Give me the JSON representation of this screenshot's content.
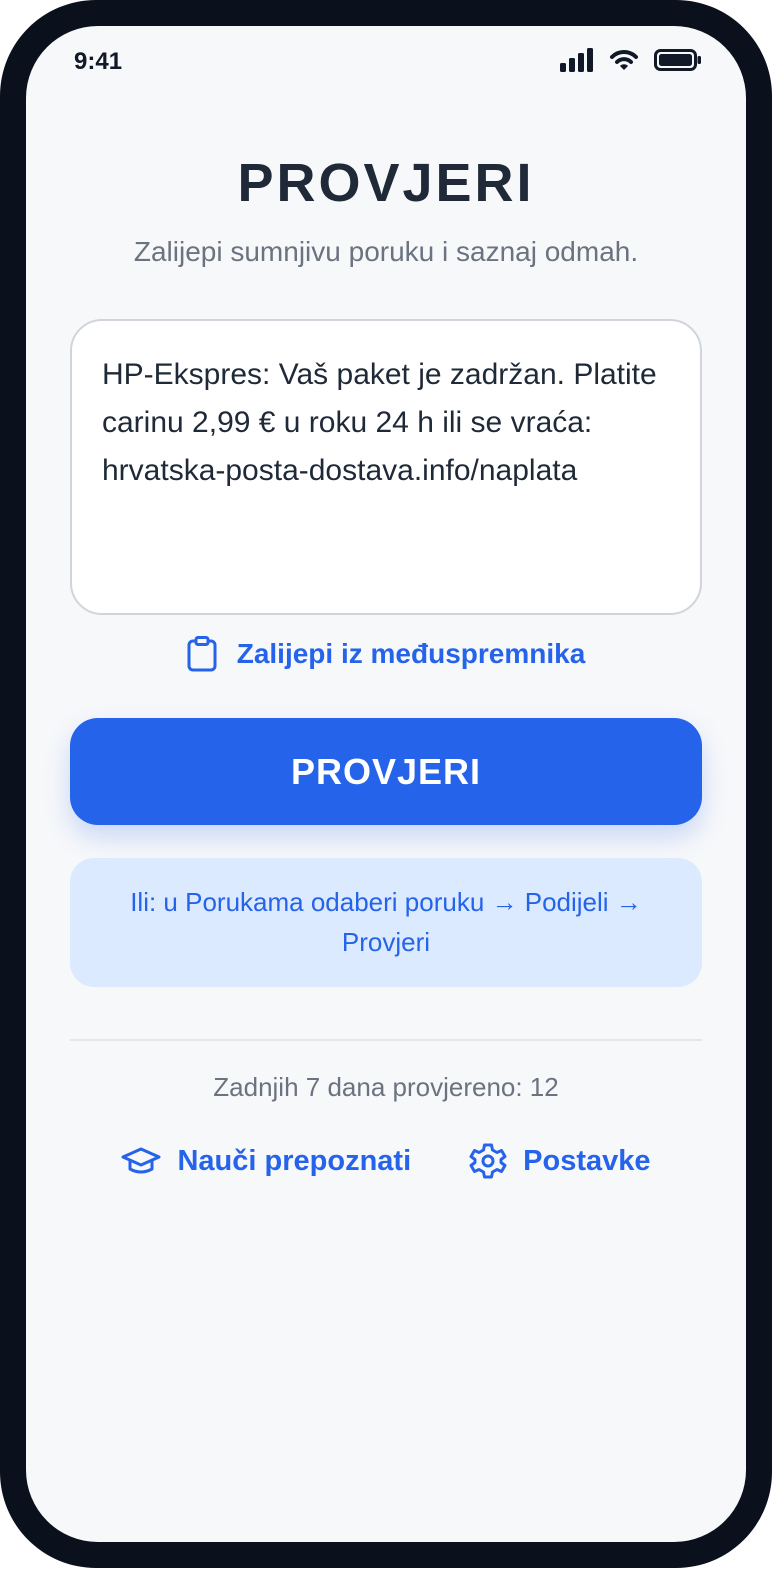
{
  "status_bar": {
    "time": "9:41",
    "icons": [
      "cellular-signal-icon",
      "wifi-icon",
      "battery-icon"
    ]
  },
  "header": {
    "title": "PROVJERI",
    "subtitle": "Zalijepi sumnjivu poruku i saznaj odmah."
  },
  "message_input": {
    "value": "HP-Ekspres: Vaš paket je zadržan. Platite carinu 2,99 € u roku 24 h ili se vraća: hrvatska-posta-dostava.info/naplata"
  },
  "paste_action": {
    "icon": "clipboard-icon",
    "label": "Zalijepi iz međuspremnika"
  },
  "check_button": {
    "label": "PROVJERI"
  },
  "hint": {
    "text": "Ili: u Porukama odaberi poruku → Podijeli → Provjeri"
  },
  "stats": {
    "text": "Zadnjih 7 dana provjereno: 12"
  },
  "footer": {
    "learn": {
      "icon": "graduation-cap-icon",
      "label": "Nauči prepoznati"
    },
    "settings": {
      "icon": "gear-icon",
      "label": "Postavke"
    }
  },
  "colors": {
    "accent": "#2563eb",
    "hint_background": "#dbeafe",
    "background": "#f7f8fa",
    "device_frame": "#0b111c",
    "title": "#1f2937",
    "muted_text": "#6b7280"
  }
}
